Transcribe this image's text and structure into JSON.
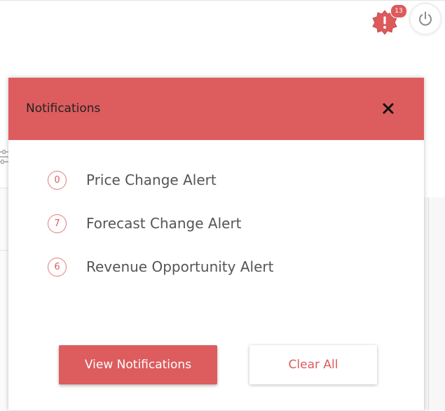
{
  "header": {
    "alert_icon": "alert-badge-icon",
    "alert_count": "13",
    "power_icon": "power-icon"
  },
  "panel": {
    "title": "Notifications",
    "close_icon": "close-icon",
    "alerts": [
      {
        "count": "0",
        "label": "Price Change Alert"
      },
      {
        "count": "7",
        "label": "Forecast Change Alert"
      },
      {
        "count": "6",
        "label": "Revenue Opportunity Alert"
      }
    ],
    "view_button": "View Notifications",
    "clear_button": "Clear All"
  },
  "colors": {
    "accent": "#dd5c5e",
    "text": "#555555",
    "title_text": "#222222",
    "background": "#ffffff"
  }
}
